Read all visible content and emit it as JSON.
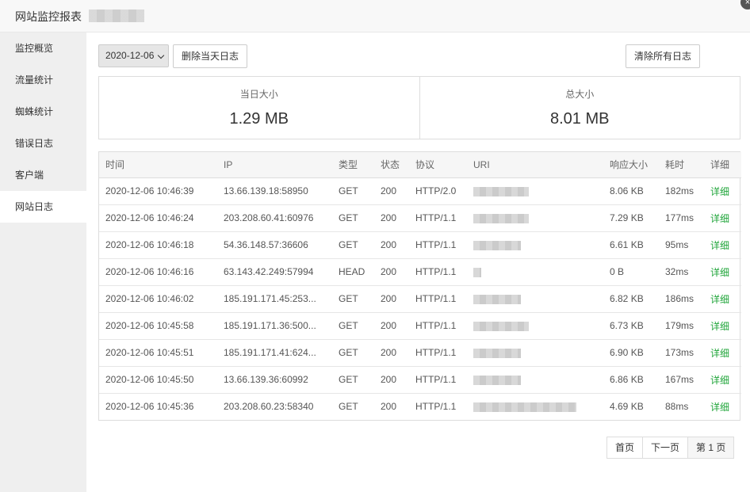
{
  "window": {
    "title": "网站监控报表",
    "close_label": "×"
  },
  "sidebar": {
    "items": [
      {
        "label": "监控概览"
      },
      {
        "label": "流量统计"
      },
      {
        "label": "蜘蛛统计"
      },
      {
        "label": "错误日志"
      },
      {
        "label": "客户端"
      },
      {
        "label": "网站日志",
        "active": true
      }
    ]
  },
  "toolbar": {
    "date_value": "2020-12-06",
    "delete_day_label": "删除当天日志",
    "clear_all_label": "清除所有日志"
  },
  "stats": {
    "today_label": "当日大小",
    "today_value": "1.29 MB",
    "total_label": "总大小",
    "total_value": "8.01 MB"
  },
  "table": {
    "headers": [
      "时间",
      "IP",
      "类型",
      "状态",
      "协议",
      "URI",
      "响应大小",
      "耗时",
      "详细"
    ],
    "rows": [
      {
        "time": "2020-12-06 10:46:39",
        "ip": "13.66.139.18:58950",
        "type": "GET",
        "status": "200",
        "protocol": "HTTP/2.0",
        "size": "8.06 KB",
        "duration": "182ms",
        "detail": "详细"
      },
      {
        "time": "2020-12-06 10:46:24",
        "ip": "203.208.60.41:60976",
        "type": "GET",
        "status": "200",
        "protocol": "HTTP/1.1",
        "size": "7.29 KB",
        "duration": "177ms",
        "detail": "详细"
      },
      {
        "time": "2020-12-06 10:46:18",
        "ip": "54.36.148.57:36606",
        "type": "GET",
        "status": "200",
        "protocol": "HTTP/1.1",
        "size": "6.61 KB",
        "duration": "95ms",
        "detail": "详细"
      },
      {
        "time": "2020-12-06 10:46:16",
        "ip": "63.143.42.249:57994",
        "type": "HEAD",
        "status": "200",
        "protocol": "HTTP/1.1",
        "size": "0 B",
        "duration": "32ms",
        "detail": "详细"
      },
      {
        "time": "2020-12-06 10:46:02",
        "ip": "185.191.171.45:253...",
        "type": "GET",
        "status": "200",
        "protocol": "HTTP/1.1",
        "size": "6.82 KB",
        "duration": "186ms",
        "detail": "详细"
      },
      {
        "time": "2020-12-06 10:45:58",
        "ip": "185.191.171.36:500...",
        "type": "GET",
        "status": "200",
        "protocol": "HTTP/1.1",
        "size": "6.73 KB",
        "duration": "179ms",
        "detail": "详细"
      },
      {
        "time": "2020-12-06 10:45:51",
        "ip": "185.191.171.41:624...",
        "type": "GET",
        "status": "200",
        "protocol": "HTTP/1.1",
        "size": "6.90 KB",
        "duration": "173ms",
        "detail": "详细"
      },
      {
        "time": "2020-12-06 10:45:50",
        "ip": "13.66.139.36:60992",
        "type": "GET",
        "status": "200",
        "protocol": "HTTP/1.1",
        "size": "6.86 KB",
        "duration": "167ms",
        "detail": "详细"
      },
      {
        "time": "2020-12-06 10:45:36",
        "ip": "203.208.60.23:58340",
        "type": "GET",
        "status": "200",
        "protocol": "HTTP/1.1",
        "size": "4.69 KB",
        "duration": "88ms",
        "detail": "详细"
      }
    ]
  },
  "pager": {
    "first": "首页",
    "next": "下一页",
    "current": "第 1 页"
  }
}
